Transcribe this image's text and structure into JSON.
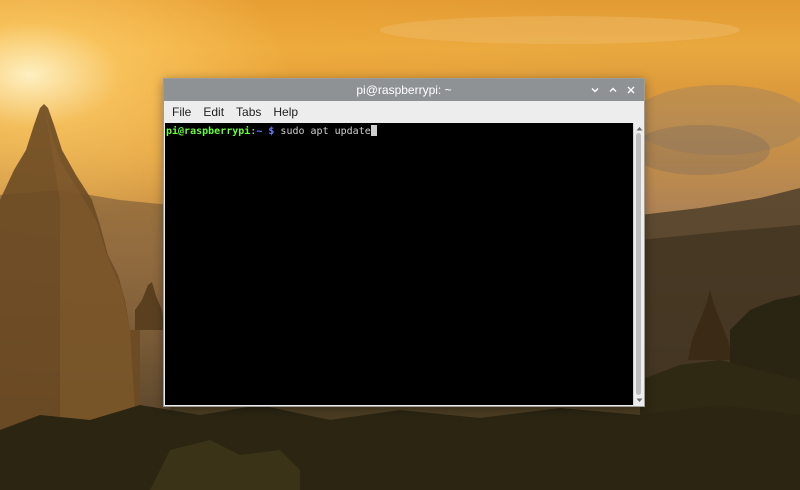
{
  "window": {
    "title": "pi@raspberrypi: ~",
    "controls": [
      "minimize-icon",
      "maximize-icon",
      "close-icon"
    ]
  },
  "menubar": {
    "items": [
      "File",
      "Edit",
      "Tabs",
      "Help"
    ]
  },
  "terminal": {
    "prompt_user_host": "pi@raspberrypi",
    "prompt_sep": ":",
    "prompt_path": "~ $",
    "command": "sudo apt update",
    "colors": {
      "user_host": "#66ff33",
      "path": "#6a7bff",
      "text": "#cfcfcf",
      "background": "#000000"
    }
  },
  "scrollbar": {
    "up_icon": "chevron-up-icon",
    "down_icon": "chevron-down-icon"
  }
}
